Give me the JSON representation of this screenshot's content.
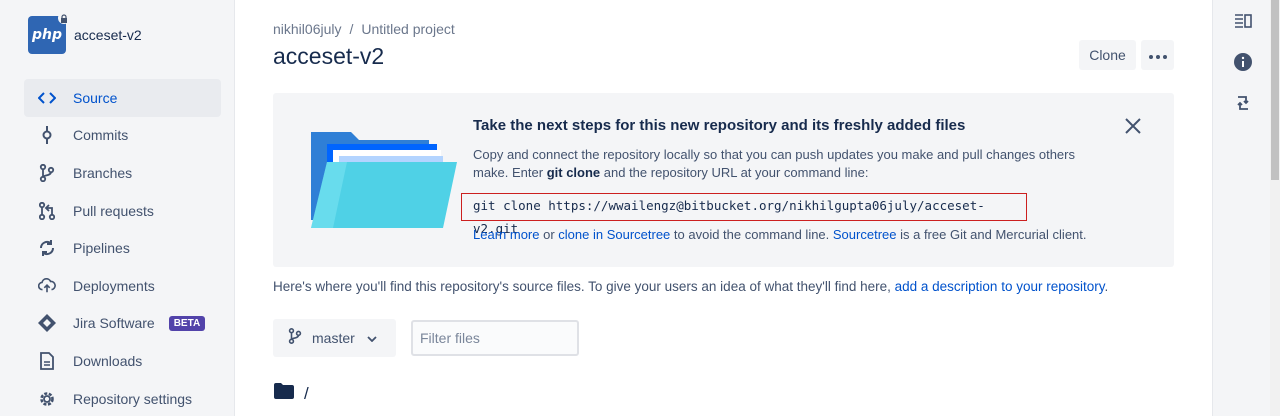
{
  "sidebar": {
    "repo_logo_text": "php",
    "repo_name": "acceset-v2",
    "items": [
      {
        "label": "Source",
        "icon": "code-icon",
        "active": true
      },
      {
        "label": "Commits",
        "icon": "commit-icon"
      },
      {
        "label": "Branches",
        "icon": "branch-icon"
      },
      {
        "label": "Pull requests",
        "icon": "pull-request-icon"
      },
      {
        "label": "Pipelines",
        "icon": "pipelines-icon"
      },
      {
        "label": "Deployments",
        "icon": "deployments-icon"
      },
      {
        "label": "Jira Software",
        "icon": "jira-icon",
        "badge": "BETA"
      },
      {
        "label": "Downloads",
        "icon": "downloads-icon"
      },
      {
        "label": "Repository settings",
        "icon": "gear-icon"
      }
    ]
  },
  "header": {
    "breadcrumb_user": "nikhil06july",
    "breadcrumb_sep": "/",
    "breadcrumb_project": "Untitled project",
    "title": "acceset-v2",
    "clone_label": "Clone"
  },
  "panel": {
    "title": "Take the next steps for this new repository and its freshly added files",
    "text_part1": "Copy and connect the repository locally so that you can push updates you make and pull changes others make. Enter ",
    "text_bold": "git clone",
    "text_part2": " and the repository URL at your command line:",
    "clone_command": "git clone https://wwailengz@bitbucket.org/nikhilgupta06july/acceset-v2.git",
    "learn_more": "Learn more",
    "or": " or ",
    "clone_sourcetree": "clone in Sourcetree",
    "avoid_text": " to avoid the command line. ",
    "sourcetree": "Sourcetree",
    "free_text": " is a free Git and Mercurial client."
  },
  "description": {
    "text": "Here's where you'll find this repository's source files. To give your users an idea of what they'll find here, ",
    "link": "add a description to your repository",
    "end": "."
  },
  "toolbar": {
    "branch": "master",
    "filter_placeholder": "Filter files"
  },
  "file_tree": {
    "root": "/"
  },
  "colors": {
    "accent": "#0052cc",
    "logo_bg": "#2f66b3",
    "badge": "#5243aa",
    "highlight_border": "#cc1f1f"
  }
}
